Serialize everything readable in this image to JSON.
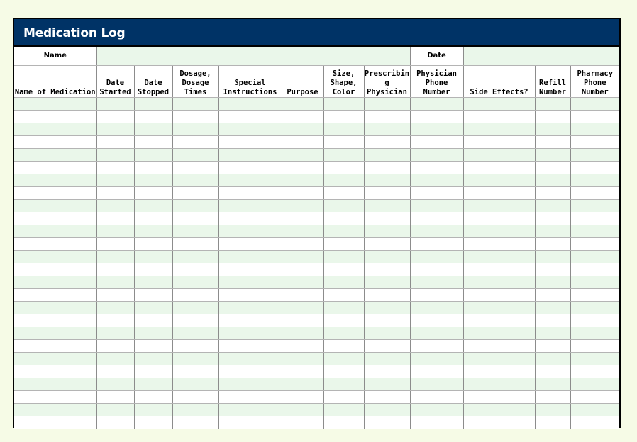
{
  "title": "Medication Log",
  "name_row": {
    "name_label": "Name",
    "name_value": "",
    "date_label": "Date",
    "date_value": ""
  },
  "columns": [
    {
      "key": "name_of_medication",
      "label": "Name of Medication"
    },
    {
      "key": "date_started",
      "label": "Date\nStarted"
    },
    {
      "key": "date_stopped",
      "label": "Date\nStopped"
    },
    {
      "key": "dosage_times",
      "label": "Dosage,\nDosage\nTimes"
    },
    {
      "key": "special_instructions",
      "label": "Special\nInstructions"
    },
    {
      "key": "purpose",
      "label": "Purpose"
    },
    {
      "key": "size_shape_color",
      "label": "Size,\nShape,\nColor"
    },
    {
      "key": "prescribing_physician",
      "label": "Prescribin\ng\nPhysician"
    },
    {
      "key": "physician_phone",
      "label": "Physician\nPhone\nNumber"
    },
    {
      "key": "side_effects",
      "label": "Side Effects?"
    },
    {
      "key": "refill_number",
      "label": "Refill\nNumber"
    },
    {
      "key": "pharmacy_phone",
      "label": "Pharmacy\nPhone\nNumber"
    }
  ],
  "rows": [
    [
      "",
      "",
      "",
      "",
      "",
      "",
      "",
      "",
      "",
      "",
      "",
      ""
    ],
    [
      "",
      "",
      "",
      "",
      "",
      "",
      "",
      "",
      "",
      "",
      "",
      ""
    ],
    [
      "",
      "",
      "",
      "",
      "",
      "",
      "",
      "",
      "",
      "",
      "",
      ""
    ],
    [
      "",
      "",
      "",
      "",
      "",
      "",
      "",
      "",
      "",
      "",
      "",
      ""
    ],
    [
      "",
      "",
      "",
      "",
      "",
      "",
      "",
      "",
      "",
      "",
      "",
      ""
    ],
    [
      "",
      "",
      "",
      "",
      "",
      "",
      "",
      "",
      "",
      "",
      "",
      ""
    ],
    [
      "",
      "",
      "",
      "",
      "",
      "",
      "",
      "",
      "",
      "",
      "",
      ""
    ],
    [
      "",
      "",
      "",
      "",
      "",
      "",
      "",
      "",
      "",
      "",
      "",
      ""
    ],
    [
      "",
      "",
      "",
      "",
      "",
      "",
      "",
      "",
      "",
      "",
      "",
      ""
    ],
    [
      "",
      "",
      "",
      "",
      "",
      "",
      "",
      "",
      "",
      "",
      "",
      ""
    ],
    [
      "",
      "",
      "",
      "",
      "",
      "",
      "",
      "",
      "",
      "",
      "",
      ""
    ],
    [
      "",
      "",
      "",
      "",
      "",
      "",
      "",
      "",
      "",
      "",
      "",
      ""
    ],
    [
      "",
      "",
      "",
      "",
      "",
      "",
      "",
      "",
      "",
      "",
      "",
      ""
    ],
    [
      "",
      "",
      "",
      "",
      "",
      "",
      "",
      "",
      "",
      "",
      "",
      ""
    ],
    [
      "",
      "",
      "",
      "",
      "",
      "",
      "",
      "",
      "",
      "",
      "",
      ""
    ],
    [
      "",
      "",
      "",
      "",
      "",
      "",
      "",
      "",
      "",
      "",
      "",
      ""
    ],
    [
      "",
      "",
      "",
      "",
      "",
      "",
      "",
      "",
      "",
      "",
      "",
      ""
    ],
    [
      "",
      "",
      "",
      "",
      "",
      "",
      "",
      "",
      "",
      "",
      "",
      ""
    ],
    [
      "",
      "",
      "",
      "",
      "",
      "",
      "",
      "",
      "",
      "",
      "",
      ""
    ],
    [
      "",
      "",
      "",
      "",
      "",
      "",
      "",
      "",
      "",
      "",
      "",
      ""
    ],
    [
      "",
      "",
      "",
      "",
      "",
      "",
      "",
      "",
      "",
      "",
      "",
      ""
    ],
    [
      "",
      "",
      "",
      "",
      "",
      "",
      "",
      "",
      "",
      "",
      "",
      ""
    ],
    [
      "",
      "",
      "",
      "",
      "",
      "",
      "",
      "",
      "",
      "",
      "",
      ""
    ],
    [
      "",
      "",
      "",
      "",
      "",
      "",
      "",
      "",
      "",
      "",
      "",
      ""
    ],
    [
      "",
      "",
      "",
      "",
      "",
      "",
      "",
      "",
      "",
      "",
      "",
      ""
    ],
    [
      "",
      "",
      "",
      "",
      "",
      "",
      "",
      "",
      "",
      "",
      "",
      ""
    ]
  ],
  "colors": {
    "title_bar": "#003366",
    "row_alt": "#eaf7ea",
    "page_background": "#f6fbe6"
  }
}
